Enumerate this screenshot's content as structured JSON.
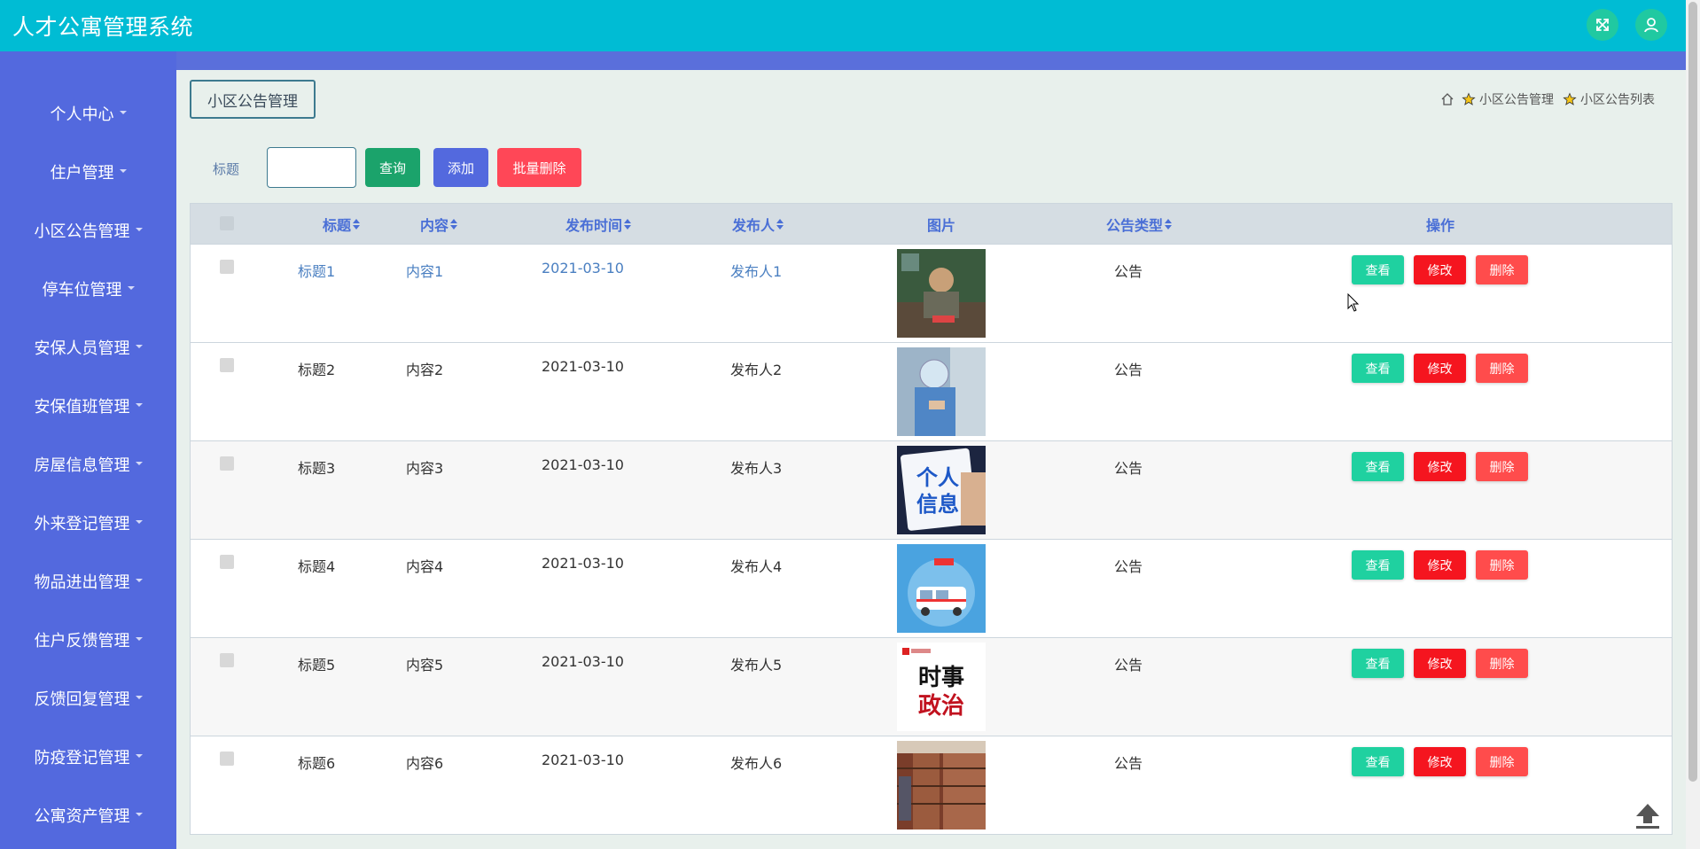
{
  "app": {
    "title": "人才公寓管理系统"
  },
  "sidebar": {
    "items": [
      {
        "label": "个人中心"
      },
      {
        "label": "住户管理"
      },
      {
        "label": "小区公告管理"
      },
      {
        "label": "停车位管理"
      },
      {
        "label": "安保人员管理"
      },
      {
        "label": "安保值班管理"
      },
      {
        "label": "房屋信息管理"
      },
      {
        "label": "外来登记管理"
      },
      {
        "label": "物品进出管理"
      },
      {
        "label": "住户反馈管理"
      },
      {
        "label": "反馈回复管理"
      },
      {
        "label": "防疫登记管理"
      },
      {
        "label": "公寓资产管理"
      }
    ]
  },
  "page": {
    "section_title": "小区公告管理",
    "breadcrumb": [
      "小区公告管理",
      "小区公告列表"
    ]
  },
  "search": {
    "label": "标题",
    "value": "",
    "placeholder": "",
    "query_label": "查询",
    "add_label": "添加",
    "batch_delete_label": "批量删除"
  },
  "table": {
    "columns": {
      "title": "标题",
      "content": "内容",
      "publish_time": "发布时间",
      "publisher": "发布人",
      "image": "图片",
      "type": "公告类型",
      "actions": "操作"
    },
    "rows": [
      {
        "title": "标题1",
        "content": "内容1",
        "publish_time": "2021-03-10",
        "publisher": "发布人1",
        "type": "公告"
      },
      {
        "title": "标题2",
        "content": "内容2",
        "publish_time": "2021-03-10",
        "publisher": "发布人2",
        "type": "公告"
      },
      {
        "title": "标题3",
        "content": "内容3",
        "publish_time": "2021-03-10",
        "publisher": "发布人3",
        "type": "公告"
      },
      {
        "title": "标题4",
        "content": "内容4",
        "publish_time": "2021-03-10",
        "publisher": "发布人4",
        "type": "公告"
      },
      {
        "title": "标题5",
        "content": "内容5",
        "publish_time": "2021-03-10",
        "publisher": "发布人5",
        "type": "公告"
      },
      {
        "title": "标题6",
        "content": "内容6",
        "publish_time": "2021-03-10",
        "publisher": "发布人6",
        "type": "公告"
      }
    ],
    "action_labels": {
      "view": "查看",
      "edit": "修改",
      "delete": "删除"
    },
    "images": [
      {
        "text": ""
      },
      {
        "text": ""
      },
      {
        "text": "个人\n信息"
      },
      {
        "text": ""
      },
      {
        "text": "时事\n政治"
      },
      {
        "text": ""
      }
    ]
  },
  "icons": {
    "fullscreen": "fullscreen-icon",
    "user": "user-icon",
    "home": "home-icon",
    "star": "star-icon",
    "back_to_top": "arrow-up-icon"
  },
  "colors": {
    "header": "#00bcd4",
    "sidebar": "#5369de",
    "query": "#1ba36b",
    "add": "#5369de",
    "batch_delete": "#ff4757",
    "view": "#1fd1a0",
    "edit": "#f5151f",
    "delete": "#ff4c4c"
  }
}
